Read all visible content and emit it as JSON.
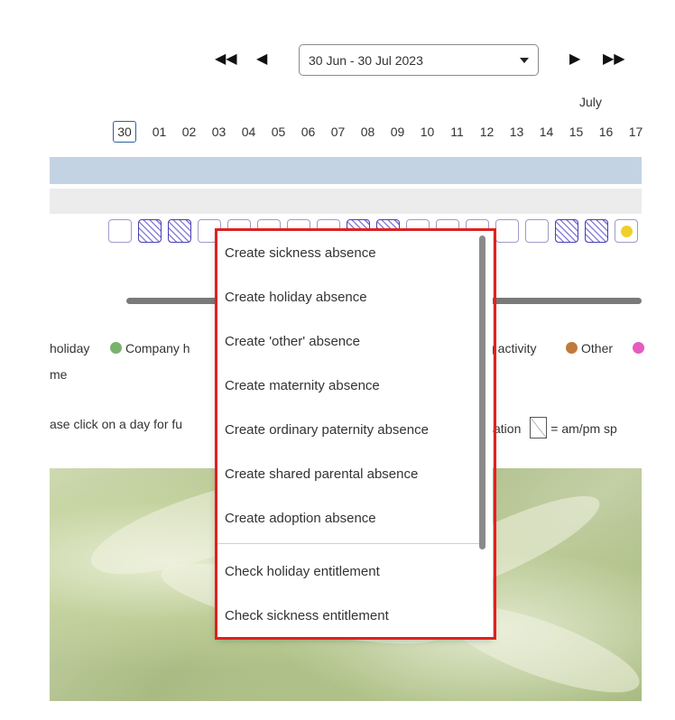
{
  "nav": {
    "first_glyph": "◀◀",
    "prev_glyph": "◀",
    "next_glyph": "▶",
    "last_glyph": "▶▶",
    "range_value": "30 Jun - 30 Jul 2023"
  },
  "calendar": {
    "month": "July",
    "days": [
      "30",
      "01",
      "02",
      "03",
      "04",
      "05",
      "06",
      "07",
      "08",
      "09",
      "10",
      "11",
      "12",
      "13",
      "14",
      "15",
      "16",
      "17"
    ],
    "cells": [
      "empty",
      "hatched",
      "hatched",
      "empty",
      "empty",
      "empty",
      "empty",
      "empty",
      "hatched",
      "hatched",
      "empty",
      "empty",
      "empty",
      "empty",
      "empty",
      "hatched",
      "hatched",
      "dot"
    ]
  },
  "legend": {
    "holiday": "holiday",
    "company": "Company h",
    "training": "g activity",
    "other": "Other",
    "line2": "me",
    "colors": {
      "company": "#79b36f",
      "other": "#c07a3c",
      "pink": "#e45cc0"
    }
  },
  "hint": {
    "text": "ase click on a day for fu",
    "text2": "sation",
    "ampm": "= am/pm sp"
  },
  "menu": {
    "create_sickness": "Create sickness absence",
    "create_holiday": "Create holiday absence",
    "create_other": "Create 'other' absence",
    "create_maternity": "Create maternity absence",
    "create_paternity": "Create ordinary paternity absence",
    "create_shared_parental": "Create shared parental absence",
    "create_adoption": "Create adoption absence",
    "check_holiday": "Check holiday entitlement",
    "check_sickness": "Check sickness entitlement"
  }
}
